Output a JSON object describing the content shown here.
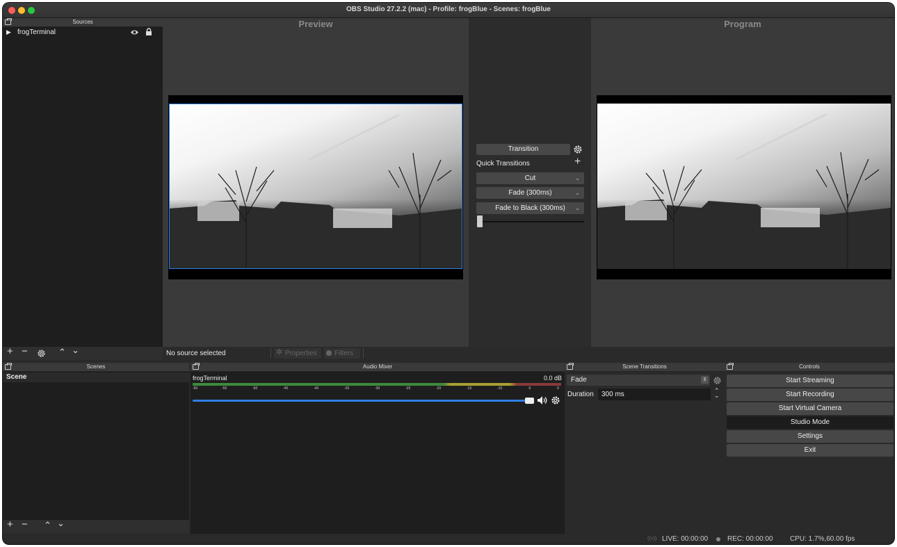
{
  "window": {
    "title": "OBS Studio 27.2.2 (mac) - Profile: frogBlue - Scenes: frogBlue"
  },
  "sources": {
    "header": "Sources",
    "items": [
      {
        "name": "frogTerminal",
        "visible": true,
        "locked": true
      }
    ]
  },
  "preview": {
    "label": "Preview"
  },
  "program": {
    "label": "Program"
  },
  "transitions_panel": {
    "transition_button": "Transition",
    "quick_transitions_label": "Quick Transitions",
    "quick": [
      "Cut",
      "Fade (300ms)",
      "Fade to Black (300ms)"
    ]
  },
  "source_toolbar": {
    "status": "No source selected",
    "properties_label": "Properties",
    "filters_label": "Filters"
  },
  "scenes": {
    "header": "Scenes",
    "items": [
      "Scene"
    ]
  },
  "audio_mixer": {
    "header": "Audio Mixer",
    "channel_name": "frogTerminal",
    "level": "0.0 dB",
    "ticks": [
      "-60",
      "-55",
      "-50",
      "-45",
      "-40",
      "-35",
      "-30",
      "-25",
      "-20",
      "-15",
      "-10",
      "-5",
      "0"
    ]
  },
  "scene_transitions": {
    "header": "Scene Transitions",
    "selected": "Fade",
    "duration_label": "Duration",
    "duration_value": "300 ms"
  },
  "controls": {
    "header": "Controls",
    "buttons": [
      "Start Streaming",
      "Start Recording",
      "Start Virtual Camera",
      "Studio Mode",
      "Settings",
      "Exit"
    ]
  },
  "statusbar": {
    "live": "LIVE: 00:00:00",
    "rec": "REC: 00:00:00",
    "cpu": "CPU: 1.7%,60.00 fps"
  },
  "colors": {
    "accent": "#2f7fe6",
    "traffic_close": "#ff5f57",
    "traffic_min": "#febc2e",
    "traffic_max": "#28c840"
  }
}
